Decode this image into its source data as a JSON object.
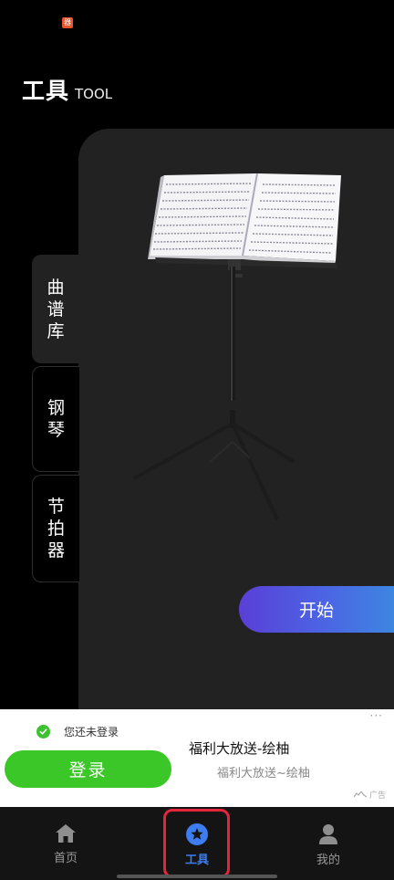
{
  "status_bar": {
    "app_icon": "app-badge-icon",
    "app_icon_text": "器"
  },
  "header": {
    "title": "工具",
    "title_en": "TOOL"
  },
  "side_tabs": [
    {
      "label": "曲\n谱\n库",
      "active": true
    },
    {
      "label": "钢\n琴",
      "active": false
    },
    {
      "label": "节\n拍\n器",
      "active": false
    }
  ],
  "main": {
    "start_label": "开始",
    "image": "music-stand"
  },
  "ad": {
    "login_status": "您还未登录",
    "login_button": "登录",
    "title": "福利大放送-绘柚",
    "subtitle": "福利大放送~绘柚",
    "ad_label": "广告",
    "menu_dots": "···"
  },
  "bottom_nav": [
    {
      "label": "首页",
      "icon": "home-icon",
      "active": false
    },
    {
      "label": "工具",
      "icon": "star-icon",
      "active": true
    },
    {
      "label": "我的",
      "icon": "user-icon",
      "active": false
    }
  ],
  "colors": {
    "accent": "#3d7df0",
    "login_green": "#3bc727",
    "highlight": "#e3263b"
  }
}
